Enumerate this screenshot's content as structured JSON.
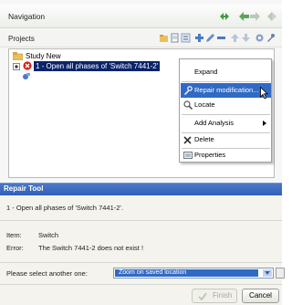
{
  "navigation": {
    "title": "Navigation",
    "projects_label": "Projects"
  },
  "tree": {
    "study_label": "Study New",
    "item_label": "1 - Open all phases of 'Switch 7441-2'"
  },
  "context_menu": {
    "items": [
      {
        "label": "Expand"
      },
      {
        "label": "Repair modification..."
      },
      {
        "label": "Locate"
      },
      {
        "label": "Add Analysis"
      },
      {
        "label": "Delete"
      },
      {
        "label": "Properties"
      }
    ]
  },
  "repair_dialog": {
    "title": "Repair Tool",
    "description": "1 - Open all phases of 'Switch 7441-2'.",
    "item_label": "Item:",
    "item_value": "Switch",
    "error_label": "Error:",
    "error_value": "The Switch 7441-2 does not exist !",
    "select_label": "Please select another one:",
    "select_value": "Zoom on saved location",
    "finish_label": "Finish",
    "cancel_label": "Cancel"
  },
  "colors": {
    "selection": "#0a246a",
    "menu_highlight": "#316ac5",
    "dialog_titlebar": "#2f5fb8",
    "error_icon": "#d42020"
  }
}
